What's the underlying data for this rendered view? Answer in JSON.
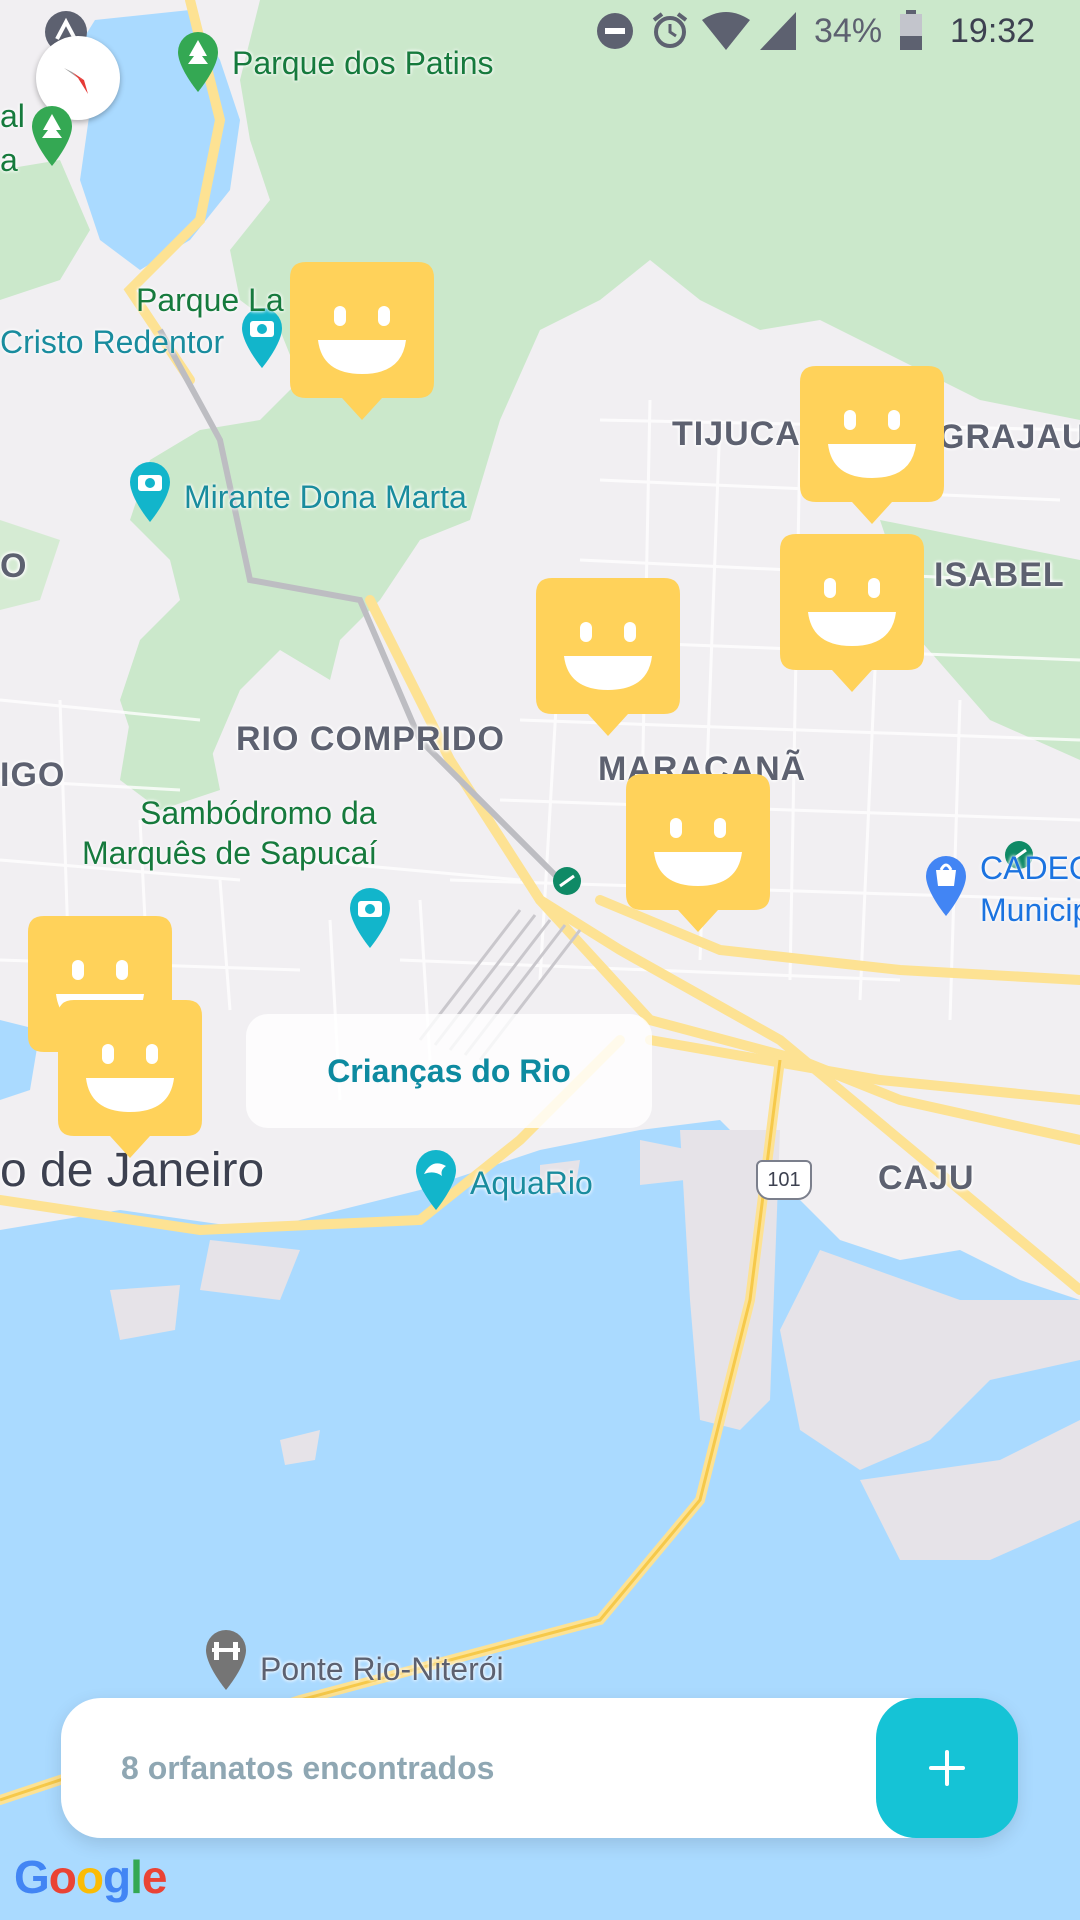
{
  "status_bar": {
    "battery": "34%",
    "time": "19:32",
    "icons": [
      "app-notification-icon",
      "do-not-disturb-icon",
      "alarm-icon",
      "wifi-icon",
      "signal-icon",
      "battery-icon"
    ]
  },
  "map": {
    "districts": {
      "tijuca": "TIJUCA",
      "grajau": "GRAJAU",
      "isabel": "ISABEL",
      "rio_comprido": "RIO COMPRIDO",
      "maracana": "MARACANÃ",
      "caju": "CAJU",
      "edge_o": "O",
      "edge_igo": "IGO"
    },
    "city": "o de Janeiro",
    "pois": {
      "parque_patins": "Parque dos Patins",
      "parque_la": "Parque La",
      "cristo": "Cristo Redentor",
      "mirante": "Mirante Dona Marta",
      "sambodromo_1": "Sambódromo da",
      "sambodromo_2": "Marquês de Sapucaí",
      "aquario": "AquaRio",
      "cadeg_1": "CADEG",
      "cadeg_2": "Municip",
      "ponte": "Ponte Rio-Niterói",
      "edge_al": "al",
      "edge_a": "a"
    },
    "road_shield": "101",
    "colors": {
      "water": "#aadaff",
      "park": "#c9e8c9",
      "land": "#f1eff2",
      "road": "#fde293",
      "marker": "#ffd25a",
      "accent": "#15c3d6"
    }
  },
  "callout": {
    "label": "Crianças do Rio"
  },
  "bottom_bar": {
    "count_text": "8 orfanatos encontrados",
    "add_button_icon": "plus-icon"
  },
  "attribution": {
    "logo": "Google"
  }
}
